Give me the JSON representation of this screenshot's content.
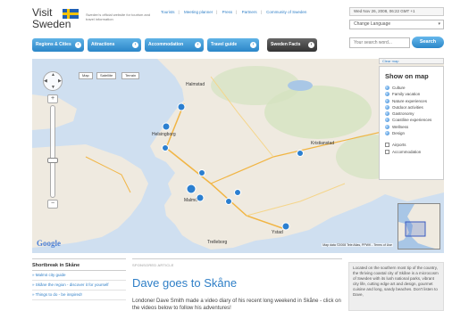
{
  "header": {
    "logo_text": "Visit\nSweden",
    "tagline": "Sweden's official website for tourism and travel information",
    "top_links": [
      "Tourists",
      "Meeting planner",
      "Press",
      "Partners",
      "Community of Sweden"
    ],
    "date": "Wed Nov 26, 2008, 06:22 GMT +1",
    "language_select": "Change Language",
    "search_placeholder": "Your search word...",
    "search_button": "Search"
  },
  "nav": {
    "items": [
      "Regions & Cities",
      "Attractions",
      "Accommodation",
      "Travel guide",
      "Sweden Facts"
    ]
  },
  "map": {
    "type_buttons": [
      "Map",
      "Satellite",
      "Terrain"
    ],
    "cities": [
      "Halmstad",
      "Helsingborg",
      "Malmö",
      "Kristianstad",
      "Ystad",
      "Trelleborg"
    ],
    "google_label": "Google",
    "attribution": "Map data ©2008 Tele Atlas, PPWK - Terms of Use",
    "clear_map": "Clear map"
  },
  "legend": {
    "title": "Show on map",
    "items": [
      "Culture",
      "Family vacation",
      "Nature experiences",
      "Outdoor activities",
      "Gastronomy",
      "Coastline experiences",
      "Wellness",
      "Design"
    ],
    "checkboxes": [
      "Airports",
      "Accommodation"
    ]
  },
  "sidebar": {
    "title": "Shortbreak in Skåne",
    "links": [
      "» Malmö city guide",
      "» Skåne the region - discover it for yourself",
      "» Things to do - be inspired!"
    ]
  },
  "article": {
    "kicker": "SPONSORED ARTICLE",
    "title": "Dave goes to Skåne",
    "body": "Londoner Dave Smith made a video diary of his recent long weekend in Skåne - click on the videos below to follow his adventures!"
  },
  "infobox": {
    "text": "Located on the southern most tip of the country, the thriving coastal city of Skåne is a microcosm of Sweden with its lush national parks, vibrant city life, cutting edge art and design, gourmet cuisine and long, sandy beaches. Don't listen to Dave,"
  },
  "colors": {
    "accent": "#2f7fc7",
    "nav_blue": "#2b86c8",
    "nav_dark": "#333333"
  }
}
